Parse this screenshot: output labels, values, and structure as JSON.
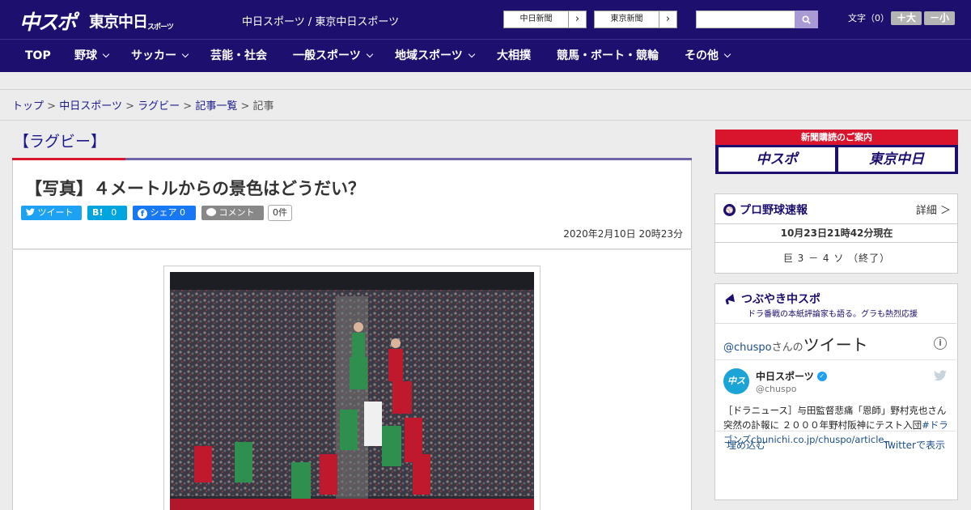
{
  "header": {
    "logo_chuspo": "中スポ",
    "logo_tokyo": "東京中日",
    "logo_tokyo_small": "スポーツ",
    "site_title": "中日スポーツ / 東京中日スポーツ",
    "paper_buttons": [
      {
        "label": "中日新聞"
      },
      {
        "label": "東京新聞"
      }
    ],
    "font_label": "文字（0）",
    "font_larger": "＋大",
    "font_smaller": "－小"
  },
  "nav": {
    "items": [
      {
        "label": "TOP",
        "has_menu": false
      },
      {
        "label": "野球",
        "has_menu": true
      },
      {
        "label": "サッカー",
        "has_menu": true
      },
      {
        "label": "芸能・社会",
        "has_menu": false
      },
      {
        "label": "一般スポーツ",
        "has_menu": true
      },
      {
        "label": "地域スポーツ",
        "has_menu": true
      },
      {
        "label": "大相撲",
        "has_menu": false
      },
      {
        "label": "競馬・ボート・競輪",
        "has_menu": false
      },
      {
        "label": "その他",
        "has_menu": true
      }
    ]
  },
  "breadcrumb": {
    "items": [
      "トップ",
      "中日スポーツ",
      "ラグビー",
      "記事一覧"
    ],
    "current": "記事",
    "separator": ">"
  },
  "article": {
    "category": "【ラグビー】",
    "title": "【写真】４メートルからの景色はどうだい？",
    "share": {
      "tweet": "ツイート",
      "hatena": "B!",
      "hatena_count": "0",
      "facebook": "シェア",
      "facebook_count": "0",
      "comment": "コメント",
      "comment_count": "0件"
    },
    "date": "2020年2月10日 20時23分"
  },
  "sidebar": {
    "ad": {
      "title": "新聞購読のご案内",
      "left": "中スポ",
      "right": "東京中日"
    },
    "baseball": {
      "title": "プロ野球速報",
      "detail": "詳細 ＞",
      "time": "10月23日21時42分現在",
      "score": "巨 3 － 4 ソ （終了）"
    },
    "tweets": {
      "title": "つぶやき中スポ",
      "subtitle": "ドラ番戦の本紙評論家も語る。グラも熱烈応援",
      "header_handle": "@chuspo",
      "header_suffix": "さんの",
      "header_big": "ツイート",
      "name": "中日スポーツ",
      "username": "@chuspo",
      "text": "［ドラニュース］与田監督悲痛「恩師」野村克也さん突然の訃報に ２０００年野村阪神にテスト入団",
      "text_link": "#ドラゴンズchunichi.co.jp/chuspo/article…",
      "embed": "埋め込む",
      "view": "Twitterで表示"
    }
  },
  "colors": {
    "brand_navy": "#1c0f6e",
    "accent_red": "#d8152c",
    "twitter_blue": "#1da1f2",
    "facebook_blue": "#1877f2",
    "hatena_blue": "#00a4de"
  }
}
